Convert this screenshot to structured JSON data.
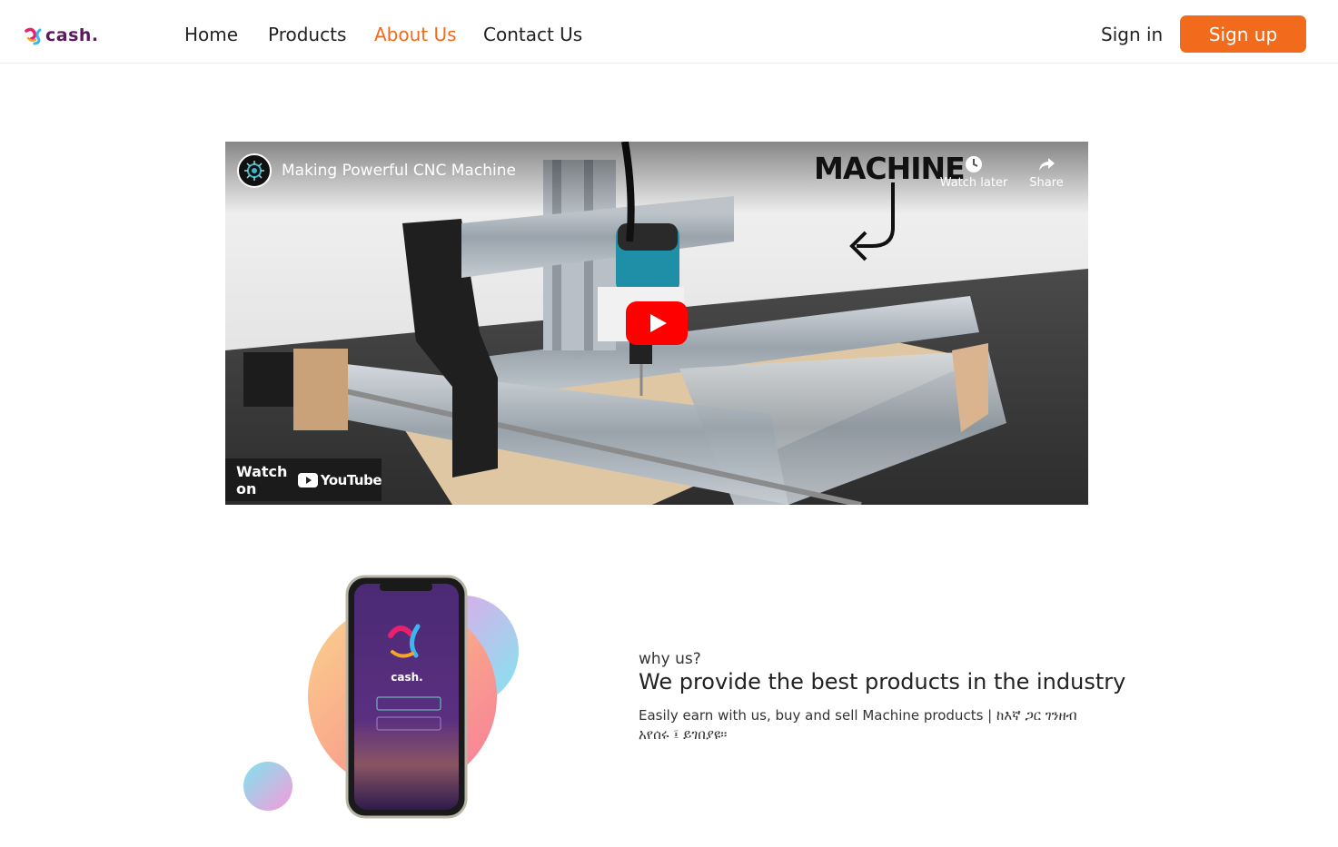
{
  "brand": {
    "logo_text": "cash.",
    "accent": "#f26a1b",
    "logo_color": "#5a1a5e"
  },
  "nav": {
    "items": [
      {
        "label": "Home",
        "active": false
      },
      {
        "label": "Products",
        "active": false
      },
      {
        "label": "About Us",
        "active": true
      },
      {
        "label": "Contact Us",
        "active": false
      }
    ],
    "sign_in": "Sign in",
    "sign_up": "Sign up"
  },
  "video": {
    "title": "Making Powerful CNC Machine",
    "overlay_text": "MACHINE",
    "watch_later": "Watch later",
    "share": "Share",
    "watch_on": "Watch on",
    "platform": "YouTube",
    "icons": [
      "channel-avatar-icon",
      "clock-icon",
      "share-arrow-icon",
      "play-icon",
      "youtube-logo-icon"
    ]
  },
  "why": {
    "label": "why us?",
    "heading": "We provide the best products in the industry",
    "description": "Easily earn with us, buy and sell Machine products | ከእኛ ጋር ገንዘብ አየሰሩ ፤ ይገበያዩ።",
    "phone_brand": "cash."
  }
}
